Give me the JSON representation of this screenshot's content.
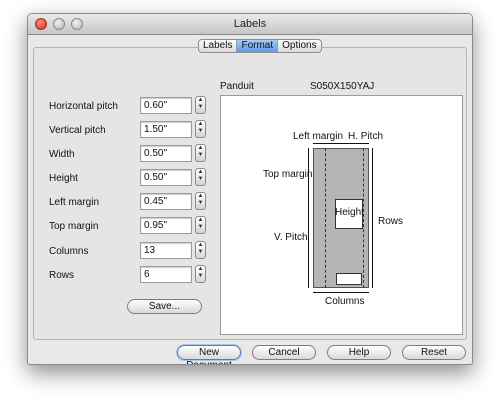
{
  "window": {
    "title": "Labels"
  },
  "tabs": [
    {
      "label": "Labels",
      "active": false
    },
    {
      "label": "Format",
      "active": true
    },
    {
      "label": "Options",
      "active": false
    }
  ],
  "form": {
    "fields": [
      {
        "label": "Horizontal pitch",
        "value": "0.60\""
      },
      {
        "label": "Vertical pitch",
        "value": "1.50\""
      },
      {
        "label": "Width",
        "value": "0.50\""
      },
      {
        "label": "Height",
        "value": "0.50\""
      },
      {
        "label": "Left margin",
        "value": "0.45\""
      },
      {
        "label": "Top margin",
        "value": "0.95\""
      },
      {
        "label": "Columns",
        "value": "13"
      },
      {
        "label": "Rows",
        "value": "6"
      }
    ],
    "save_label": "Save..."
  },
  "preview": {
    "manufacturer": "Panduit",
    "part_number": "S050X150YAJ",
    "labels": {
      "left_margin": "Left margin",
      "h_pitch": "H. Pitch",
      "top_margin": "Top margin",
      "v_pitch": "V. Pitch",
      "height": "Height",
      "rows": "Rows",
      "columns": "Columns"
    }
  },
  "buttons": {
    "new_document": "New Document",
    "cancel": "Cancel",
    "help": "Help",
    "reset": "Reset"
  },
  "colors": {
    "active_tab": "#5b9be5",
    "close_button": "#d2291c",
    "sheet": "#b5b5b5"
  }
}
